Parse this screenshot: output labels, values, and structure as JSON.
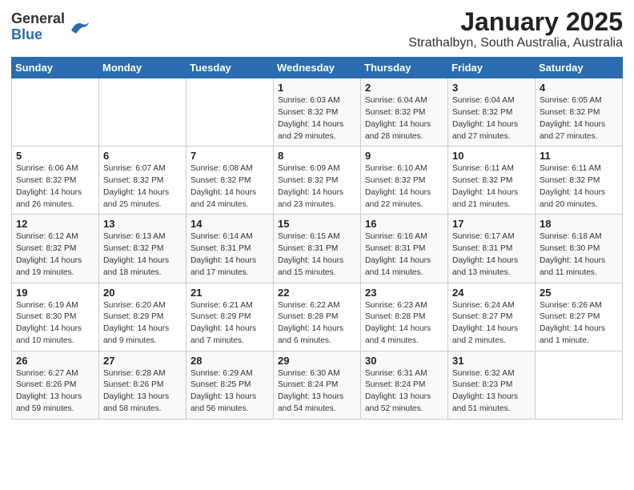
{
  "header": {
    "logo_general": "General",
    "logo_blue": "Blue",
    "title": "January 2025",
    "subtitle": "Strathalbyn, South Australia, Australia"
  },
  "weekdays": [
    "Sunday",
    "Monday",
    "Tuesday",
    "Wednesday",
    "Thursday",
    "Friday",
    "Saturday"
  ],
  "weeks": [
    [
      {
        "day": "",
        "info": ""
      },
      {
        "day": "",
        "info": ""
      },
      {
        "day": "",
        "info": ""
      },
      {
        "day": "1",
        "info": "Sunrise: 6:03 AM\nSunset: 8:32 PM\nDaylight: 14 hours\nand 29 minutes."
      },
      {
        "day": "2",
        "info": "Sunrise: 6:04 AM\nSunset: 8:32 PM\nDaylight: 14 hours\nand 28 minutes."
      },
      {
        "day": "3",
        "info": "Sunrise: 6:04 AM\nSunset: 8:32 PM\nDaylight: 14 hours\nand 27 minutes."
      },
      {
        "day": "4",
        "info": "Sunrise: 6:05 AM\nSunset: 8:32 PM\nDaylight: 14 hours\nand 27 minutes."
      }
    ],
    [
      {
        "day": "5",
        "info": "Sunrise: 6:06 AM\nSunset: 8:32 PM\nDaylight: 14 hours\nand 26 minutes."
      },
      {
        "day": "6",
        "info": "Sunrise: 6:07 AM\nSunset: 8:32 PM\nDaylight: 14 hours\nand 25 minutes."
      },
      {
        "day": "7",
        "info": "Sunrise: 6:08 AM\nSunset: 8:32 PM\nDaylight: 14 hours\nand 24 minutes."
      },
      {
        "day": "8",
        "info": "Sunrise: 6:09 AM\nSunset: 8:32 PM\nDaylight: 14 hours\nand 23 minutes."
      },
      {
        "day": "9",
        "info": "Sunrise: 6:10 AM\nSunset: 8:32 PM\nDaylight: 14 hours\nand 22 minutes."
      },
      {
        "day": "10",
        "info": "Sunrise: 6:11 AM\nSunset: 8:32 PM\nDaylight: 14 hours\nand 21 minutes."
      },
      {
        "day": "11",
        "info": "Sunrise: 6:11 AM\nSunset: 8:32 PM\nDaylight: 14 hours\nand 20 minutes."
      }
    ],
    [
      {
        "day": "12",
        "info": "Sunrise: 6:12 AM\nSunset: 8:32 PM\nDaylight: 14 hours\nand 19 minutes."
      },
      {
        "day": "13",
        "info": "Sunrise: 6:13 AM\nSunset: 8:32 PM\nDaylight: 14 hours\nand 18 minutes."
      },
      {
        "day": "14",
        "info": "Sunrise: 6:14 AM\nSunset: 8:31 PM\nDaylight: 14 hours\nand 17 minutes."
      },
      {
        "day": "15",
        "info": "Sunrise: 6:15 AM\nSunset: 8:31 PM\nDaylight: 14 hours\nand 15 minutes."
      },
      {
        "day": "16",
        "info": "Sunrise: 6:16 AM\nSunset: 8:31 PM\nDaylight: 14 hours\nand 14 minutes."
      },
      {
        "day": "17",
        "info": "Sunrise: 6:17 AM\nSunset: 8:31 PM\nDaylight: 14 hours\nand 13 minutes."
      },
      {
        "day": "18",
        "info": "Sunrise: 6:18 AM\nSunset: 8:30 PM\nDaylight: 14 hours\nand 11 minutes."
      }
    ],
    [
      {
        "day": "19",
        "info": "Sunrise: 6:19 AM\nSunset: 8:30 PM\nDaylight: 14 hours\nand 10 minutes."
      },
      {
        "day": "20",
        "info": "Sunrise: 6:20 AM\nSunset: 8:29 PM\nDaylight: 14 hours\nand 9 minutes."
      },
      {
        "day": "21",
        "info": "Sunrise: 6:21 AM\nSunset: 8:29 PM\nDaylight: 14 hours\nand 7 minutes."
      },
      {
        "day": "22",
        "info": "Sunrise: 6:22 AM\nSunset: 8:28 PM\nDaylight: 14 hours\nand 6 minutes."
      },
      {
        "day": "23",
        "info": "Sunrise: 6:23 AM\nSunset: 8:28 PM\nDaylight: 14 hours\nand 4 minutes."
      },
      {
        "day": "24",
        "info": "Sunrise: 6:24 AM\nSunset: 8:27 PM\nDaylight: 14 hours\nand 2 minutes."
      },
      {
        "day": "25",
        "info": "Sunrise: 6:26 AM\nSunset: 8:27 PM\nDaylight: 14 hours\nand 1 minute."
      }
    ],
    [
      {
        "day": "26",
        "info": "Sunrise: 6:27 AM\nSunset: 8:26 PM\nDaylight: 13 hours\nand 59 minutes."
      },
      {
        "day": "27",
        "info": "Sunrise: 6:28 AM\nSunset: 8:26 PM\nDaylight: 13 hours\nand 58 minutes."
      },
      {
        "day": "28",
        "info": "Sunrise: 6:29 AM\nSunset: 8:25 PM\nDaylight: 13 hours\nand 56 minutes."
      },
      {
        "day": "29",
        "info": "Sunrise: 6:30 AM\nSunset: 8:24 PM\nDaylight: 13 hours\nand 54 minutes."
      },
      {
        "day": "30",
        "info": "Sunrise: 6:31 AM\nSunset: 8:24 PM\nDaylight: 13 hours\nand 52 minutes."
      },
      {
        "day": "31",
        "info": "Sunrise: 6:32 AM\nSunset: 8:23 PM\nDaylight: 13 hours\nand 51 minutes."
      },
      {
        "day": "",
        "info": ""
      }
    ]
  ]
}
